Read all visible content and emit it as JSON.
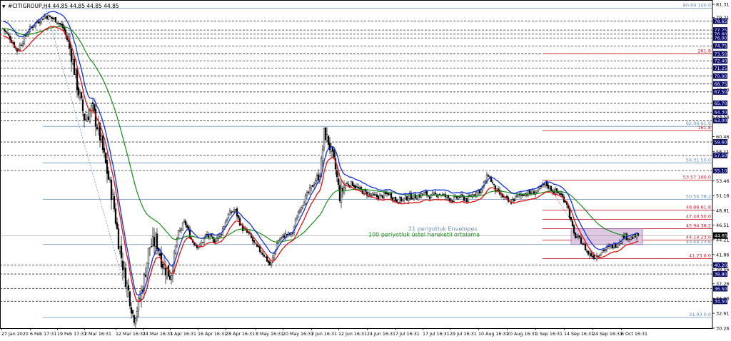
{
  "chart_data": {
    "type": "candlestick",
    "title": "#CITIGROUP,H4",
    "ohlc_text": "44.85 44.85 44.85 44.85",
    "ylim": [
      30.26,
      81.31
    ],
    "x_ticks": [
      "27 Jan 2020",
      "6 Feb 17:31",
      "19 Feb 17:31",
      "2 Mar 16:31",
      "12 Mar 16:31",
      "24 Mar 16:31",
      "3 Apr 16:31",
      "16 Apr 16:31",
      "28 Apr 16:31",
      "8 May 16:31",
      "20 May 16:31",
      "2 Jun 16:31",
      "12 Jun 16:31",
      "24 Jun 16:31",
      "7 Jul 16:31",
      "17 Jul 16:31",
      "29 Jul 16:31",
      "10 Aug 16:31",
      "20 Aug 16:31",
      "1 Sep 16:31",
      "14 Sep 16:31",
      "24 Sep 16:31",
      "6 Oct 16:31"
    ],
    "y_ticks_plain": [
      "81.31",
      "79.21",
      "67.80",
      "63.56",
      "60.46",
      "58.11",
      "53.46",
      "51.16",
      "48.81",
      "46.51",
      "44.21",
      "41.86",
      "39.56",
      "37.26",
      "34.96",
      "32.61",
      "30.26"
    ],
    "y_ticks_boxed": [
      "78.65",
      "77.25",
      "76.60",
      "76.00",
      "74.75",
      "73.50",
      "72.40",
      "71.25",
      "70.00",
      "68.75",
      "67.50",
      "65.70",
      "64.30",
      "63.00",
      "59.60",
      "57.50",
      "55.10",
      "40.20",
      "38.80",
      "36.50",
      "34.50"
    ],
    "current_price": "44.85",
    "levels": [
      {
        "value": 80.69,
        "label": "80.69 100.0",
        "color": "#6a8fb8"
      },
      {
        "value": 73.5,
        "label": "261.8",
        "color": "#cc2030"
      },
      {
        "value": 62.06,
        "label": "62.06 61.8",
        "color": "#6a8fb8"
      },
      {
        "value": 61.4,
        "label": "161.8",
        "color": "#cc2030"
      },
      {
        "value": 56.31,
        "label": "56.31 50.0",
        "color": "#6a8fb8"
      },
      {
        "value": 53.57,
        "label": "53.57 100.0",
        "color": "#cc2030"
      },
      {
        "value": 50.56,
        "label": "50.56 38.2",
        "color": "#6a8fb8"
      },
      {
        "value": 48.86,
        "label": "48.86 61.8",
        "color": "#cc2030"
      },
      {
        "value": 47.4,
        "label": "47.40 50.0",
        "color": "#cc2030"
      },
      {
        "value": 45.94,
        "label": "45.94 38.2",
        "color": "#cc2030"
      },
      {
        "value": 44.14,
        "label": "44.14 23.6",
        "color": "#cc2030"
      },
      {
        "value": 43.44,
        "label": "43.44 23.6",
        "color": "#6a8fb8"
      },
      {
        "value": 41.23,
        "label": "41.23 0.0",
        "color": "#cc2030"
      },
      {
        "value": 31.93,
        "label": "31.93 0.0",
        "color": "#6a8fb8"
      }
    ],
    "annotations": [
      "21 periyotluk Envelopes",
      "100 periyotluk üstel hareketli ortalama"
    ],
    "price_path": [
      [
        0,
        77.5
      ],
      [
        10,
        76
      ],
      [
        20,
        74
      ],
      [
        35,
        77
      ],
      [
        45,
        78.3
      ],
      [
        60,
        79.5
      ],
      [
        75,
        78.8
      ],
      [
        85,
        77.5
      ],
      [
        95,
        74
      ],
      [
        105,
        68
      ],
      [
        115,
        63
      ],
      [
        125,
        65
      ],
      [
        135,
        61
      ],
      [
        145,
        55.5
      ],
      [
        155,
        50
      ],
      [
        162,
        44
      ],
      [
        170,
        39
      ],
      [
        178,
        35
      ],
      [
        183,
        31.9
      ],
      [
        190,
        34
      ],
      [
        198,
        38
      ],
      [
        205,
        43
      ],
      [
        215,
        44
      ],
      [
        225,
        40
      ],
      [
        235,
        38.5
      ],
      [
        245,
        45
      ],
      [
        255,
        47
      ],
      [
        265,
        44
      ],
      [
        275,
        43
      ],
      [
        285,
        45
      ],
      [
        295,
        44
      ],
      [
        305,
        45
      ],
      [
        315,
        48
      ],
      [
        325,
        49
      ],
      [
        335,
        46
      ],
      [
        345,
        45
      ],
      [
        355,
        43
      ],
      [
        365,
        42
      ],
      [
        375,
        40
      ],
      [
        385,
        44
      ],
      [
        395,
        45
      ],
      [
        405,
        45
      ],
      [
        415,
        49
      ],
      [
        425,
        51
      ],
      [
        435,
        53
      ],
      [
        445,
        55
      ],
      [
        450,
        61
      ],
      [
        455,
        60
      ],
      [
        465,
        56
      ],
      [
        472,
        51
      ],
      [
        480,
        53
      ],
      [
        490,
        53
      ],
      [
        500,
        52
      ],
      [
        510,
        51.5
      ],
      [
        520,
        51
      ],
      [
        530,
        51
      ],
      [
        540,
        51.5
      ],
      [
        550,
        50.5
      ],
      [
        560,
        50.5
      ],
      [
        570,
        51
      ],
      [
        580,
        51
      ],
      [
        590,
        51.5
      ],
      [
        600,
        51
      ],
      [
        610,
        51.5
      ],
      [
        620,
        51
      ],
      [
        630,
        50.5
      ],
      [
        640,
        51
      ],
      [
        650,
        50.5
      ],
      [
        660,
        51.5
      ],
      [
        670,
        52
      ],
      [
        680,
        54.5
      ],
      [
        690,
        52
      ],
      [
        700,
        51
      ],
      [
        710,
        50
      ],
      [
        720,
        51
      ],
      [
        730,
        51.5
      ],
      [
        740,
        51.5
      ],
      [
        750,
        52
      ],
      [
        760,
        53
      ],
      [
        770,
        52
      ],
      [
        780,
        51.5
      ],
      [
        790,
        50
      ],
      [
        795,
        47.5
      ],
      [
        800,
        45
      ],
      [
        810,
        44
      ],
      [
        820,
        42
      ],
      [
        830,
        41.5
      ],
      [
        840,
        42.5
      ],
      [
        850,
        43
      ],
      [
        860,
        43.5
      ],
      [
        870,
        44.8
      ],
      [
        880,
        44.5
      ],
      [
        890,
        44.85
      ]
    ]
  }
}
